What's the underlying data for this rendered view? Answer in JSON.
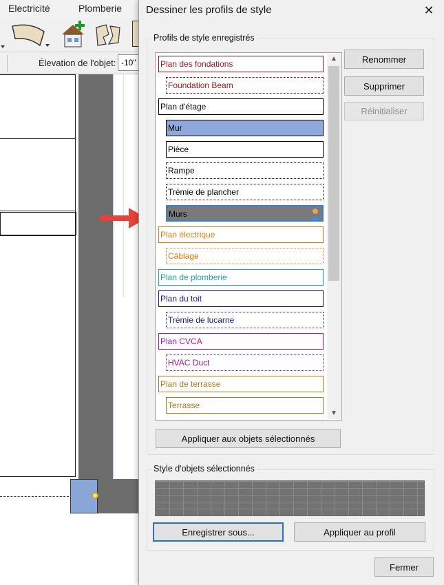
{
  "app": {
    "menu": [
      "Electricité",
      "Plomberie"
    ],
    "elevation_label": "Élevation de l'objet:",
    "elevation_value": "-10\""
  },
  "dialog": {
    "title": "Dessiner les profils de style",
    "saved_group_title": "Profils de style enregistrés",
    "profiles": [
      {
        "label": "Plan des fondations",
        "color": "#a01818",
        "border": "solid",
        "level": 0
      },
      {
        "label": "Foundation Beam",
        "color": "#a01818",
        "border": "dashed",
        "level": 1
      },
      {
        "label": "Plan d'étage",
        "color": "#000000",
        "border": "solid",
        "level": 0
      },
      {
        "label": "Mur",
        "color": "#000000",
        "border": "solid",
        "level": 1,
        "fill": "#8fa8dc"
      },
      {
        "label": "Pièce",
        "color": "#000000",
        "border": "solid",
        "level": 1
      },
      {
        "label": "Rampe",
        "color": "#000000",
        "border": "dotted",
        "level": 1
      },
      {
        "label": "Trémie de plancher",
        "color": "#000000",
        "border": "dotted",
        "level": 1
      },
      {
        "label": "Murs",
        "color": "#000000",
        "border": "solid",
        "level": 1,
        "selected": true
      },
      {
        "label": "Plan électrique",
        "color": "#e07a10",
        "border": "solid",
        "level": 0
      },
      {
        "label": "Câblage",
        "color": "#e07a10",
        "border": "dotted",
        "level": 1
      },
      {
        "label": "Plan de plomberie",
        "color": "#18a8a8",
        "border": "solid",
        "level": 0
      },
      {
        "label": "Plan du toit",
        "color": "#1a1a8c",
        "border": "solid",
        "level": 0
      },
      {
        "label": "Trémie de lucarne",
        "color": "#1a1a8c",
        "border": "dotted",
        "level": 1
      },
      {
        "label": "Plan CVCA",
        "color": "#a018a0",
        "border": "solid",
        "level": 0
      },
      {
        "label": "HVAC Duct",
        "color": "#a018a0",
        "border": "dotted",
        "level": 1
      },
      {
        "label": "Plan de terrasse",
        "color": "#b07a18",
        "border": "solid",
        "level": 0
      },
      {
        "label": "Terrasse",
        "color": "#b07a18",
        "border": "solid",
        "level": 1
      }
    ],
    "buttons": {
      "rename": "Renommer",
      "delete": "Supprimer",
      "reset": "Réinitialiser",
      "apply_selected": "Appliquer aux objets sélectionnés",
      "save_as": "Enregistrer sous...",
      "apply_profile": "Appliquer au profil",
      "close": "Fermer"
    },
    "selected_group_title": "Style d'objets sélectionnés"
  }
}
